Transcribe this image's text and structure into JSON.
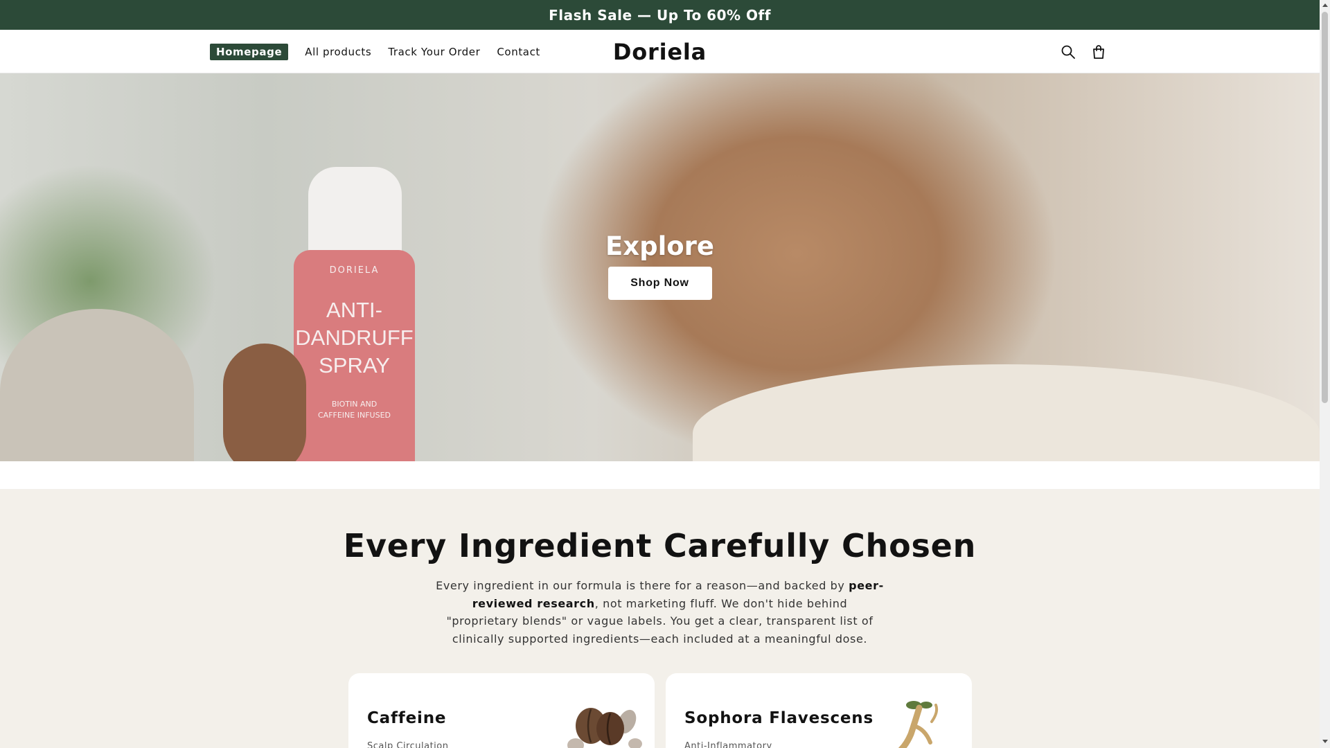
{
  "announcement": {
    "text": "Flash Sale — Up To 60% Off"
  },
  "header": {
    "logo": "Doriela",
    "nav": [
      {
        "label": "Homepage",
        "active": true
      },
      {
        "label": "All products",
        "active": false
      },
      {
        "label": "Track Your Order",
        "active": false
      },
      {
        "label": "Contact",
        "active": false
      }
    ],
    "icons": [
      "search-icon",
      "shopping-bag-icon"
    ]
  },
  "hero": {
    "title": "Explore",
    "button_label": "Shop Now",
    "product": {
      "brand": "DORIELA",
      "name_lines": [
        "ANTI-",
        "DANDRUFF",
        "SPRAY"
      ],
      "sub_lines": [
        "BIOTIN AND",
        "CAFFEINE INFUSED"
      ]
    }
  },
  "ingredients": {
    "heading": "Every Ingredient Carefully Chosen",
    "intro_before": "Every ingredient in our formula is there for a reason—and backed by ",
    "intro_bold": "peer-reviewed research",
    "intro_after": ", not marketing fluff. We don't hide behind \"proprietary blends\" or vague labels. You get a clear, transparent list of clinically supported ingredients—each included at a meaningful dose.",
    "cards": [
      {
        "title": "Caffeine",
        "subtitle": "Scalp Circulation",
        "icon": "coffee-beans-icon"
      },
      {
        "title": "Sophora Flavescens",
        "subtitle": "Anti-Inflammatory",
        "icon": "root-sprout-icon"
      }
    ]
  },
  "colors": {
    "brand_green": "#2c4a38",
    "section_bg": "#f3f0ea",
    "bottle_pink": "#d97c7e"
  }
}
